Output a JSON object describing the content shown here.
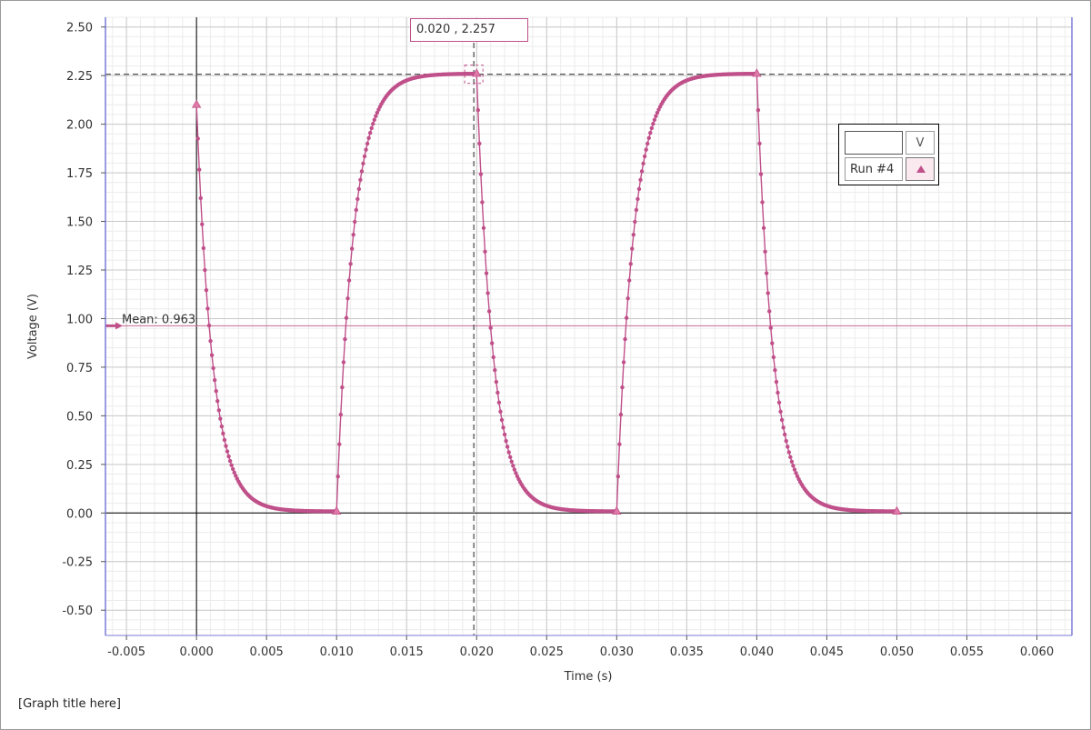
{
  "graph_title": "[Graph title here]",
  "readout": {
    "x": "0.020",
    "y": "2.257",
    "separator": " , "
  },
  "mean": {
    "label": "Mean: 0.963",
    "value": 0.963
  },
  "legend": {
    "unit": "V",
    "run_label": "Run #4",
    "marker_icon": "triangle-up-icon"
  },
  "colors": {
    "series": "#c0508a",
    "mean_line": "#c86a95",
    "background": "#ffffff"
  },
  "chart_data": {
    "type": "scatter",
    "title": "[Graph title here]",
    "xlabel": "Time (s)",
    "ylabel": "Voltage (V)",
    "xlim": [
      -0.0065,
      0.0625
    ],
    "ylim": [
      -0.63,
      2.55
    ],
    "xticks": [
      "-0.005",
      "0.000",
      "0.005",
      "0.010",
      "0.015",
      "0.020",
      "0.025",
      "0.030",
      "0.035",
      "0.040",
      "0.045",
      "0.050",
      "0.055",
      "0.060"
    ],
    "yticks": [
      "-0.50",
      "-0.25",
      "0.00",
      "0.25",
      "0.50",
      "0.75",
      "1.00",
      "1.25",
      "1.50",
      "1.75",
      "2.00",
      "2.25",
      "2.50"
    ],
    "grid": true,
    "legend_position": "top-right",
    "cursor": {
      "x": 0.0198,
      "y": 2.257
    },
    "series": [
      {
        "name": "Run #4",
        "marker": "circle",
        "model": {
          "sample_interval": 0.0001,
          "x_start": 0,
          "x_end": 0.05,
          "period": 0.02,
          "high_duration": 0.01,
          "high_level": 2.26,
          "low_level": 0.008,
          "initial_value": 2.1,
          "discharge_time_constant": 0.00115,
          "charge_time_constant": 0.0012
        },
        "triangle_markers_x": [
          0.0,
          0.01,
          0.02,
          0.03,
          0.04,
          0.05
        ]
      }
    ]
  }
}
